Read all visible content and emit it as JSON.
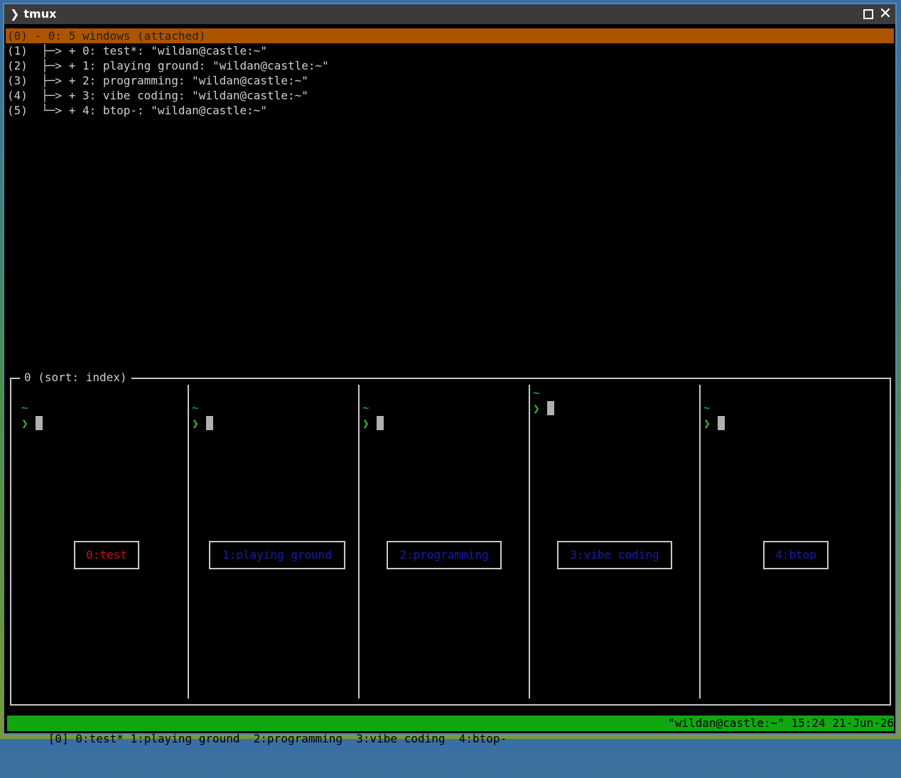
{
  "window": {
    "title": "tmux",
    "title_icon": "chevron-right-icon"
  },
  "tree": {
    "selected": "(0) - 0: 5 windows (attached)",
    "items": [
      {
        "label": "(1)  ├─> + 0: test*: \"wildan@castle:~\""
      },
      {
        "label": "(2)  ├─> + 1: playing ground: \"wildan@castle:~\""
      },
      {
        "label": "(3)  ├─> + 2: programming: \"wildan@castle:~\""
      },
      {
        "label": "(4)  ├─> + 3: vibe coding: \"wildan@castle:~\""
      },
      {
        "label": "(5)  └─> + 4: btop-: \"wildan@castle:~\""
      }
    ]
  },
  "preview": {
    "header": "0 (sort: index)",
    "panes": [
      {
        "tilde": "~",
        "prompt": "❯",
        "window_label": "0:test",
        "active": true
      },
      {
        "tilde": "~",
        "prompt": "❯",
        "window_label": "1:playing ground",
        "active": false
      },
      {
        "tilde": "~",
        "prompt": "❯",
        "window_label": "2:programming",
        "active": false
      },
      {
        "tilde": "~",
        "prompt": "❯",
        "window_label": "3:vibe coding",
        "active": false
      },
      {
        "tilde": "~",
        "prompt": "❯",
        "window_label": "4:btop",
        "active": false
      }
    ]
  },
  "statusbar": {
    "left": "[0] 0:test* 1:playing ground  2:programming  3:vibe coding  4:btop-",
    "right": "\"wildan@castle:~\" 15:24 21-Jun-26"
  },
  "colors": {
    "selection": "#ad5400",
    "status_bg": "#10a810",
    "active_label": "#d01010",
    "inactive_label": "#1a1ab0",
    "tilde": "#1aa7c4",
    "prompt": "#2fbf2f"
  }
}
